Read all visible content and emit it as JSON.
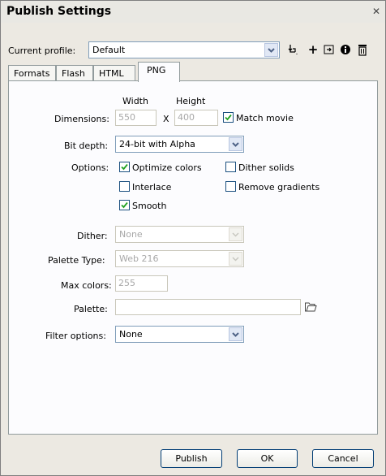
{
  "window": {
    "title": "Publish Settings",
    "close_glyph": "✕"
  },
  "profile": {
    "label": "Current profile:",
    "value": "Default"
  },
  "toolbar": {
    "icons": [
      "import-export-icon",
      "add-profile-icon",
      "duplicate-profile-icon",
      "profile-info-icon",
      "delete-profile-icon"
    ]
  },
  "tabs": [
    {
      "label": "Formats",
      "active": false
    },
    {
      "label": "Flash",
      "active": false
    },
    {
      "label": "HTML",
      "active": false
    },
    {
      "label": "PNG",
      "active": true
    }
  ],
  "dimensions": {
    "label": "Dimensions:",
    "width_label": "Width",
    "height_label": "Height",
    "width": "550",
    "height": "400",
    "x": "X",
    "match_movie": {
      "label": "Match movie",
      "checked": true
    }
  },
  "bit_depth": {
    "label": "Bit depth:",
    "value": "24-bit with Alpha"
  },
  "options": {
    "label": "Options:",
    "optimize_colors": {
      "label": "Optimize colors",
      "checked": true
    },
    "interlace": {
      "label": "Interlace",
      "checked": false
    },
    "smooth": {
      "label": "Smooth",
      "checked": true
    },
    "dither_solids": {
      "label": "Dither solids",
      "checked": false
    },
    "remove_gradients": {
      "label": "Remove gradients",
      "checked": false
    }
  },
  "dither": {
    "label": "Dither:",
    "value": "None"
  },
  "palette_type": {
    "label": "Palette Type:",
    "value": "Web 216"
  },
  "max_colors": {
    "label": "Max colors:",
    "value": "255"
  },
  "palette": {
    "label": "Palette:",
    "value": ""
  },
  "filter_options": {
    "label": "Filter options:",
    "value": "None"
  },
  "buttons": {
    "publish": "Publish",
    "ok": "OK",
    "cancel": "Cancel"
  }
}
